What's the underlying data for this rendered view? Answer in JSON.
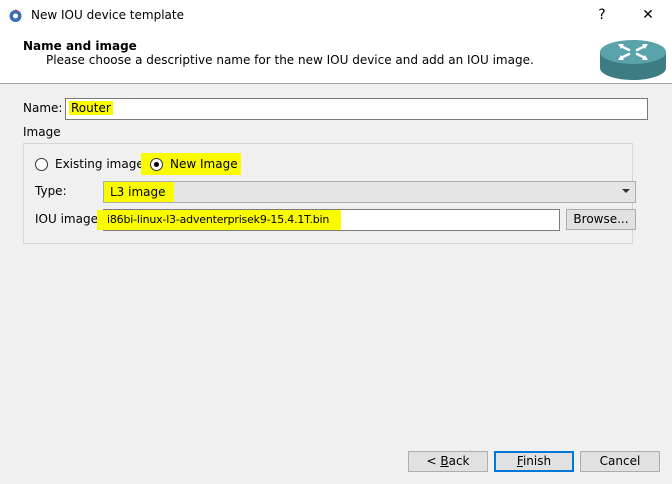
{
  "window": {
    "title": "New IOU device template",
    "help_label": "?",
    "close_label": "✕"
  },
  "header": {
    "title": "Name and image",
    "subtitle": "Please choose a descriptive name for the new IOU device and add an IOU image."
  },
  "form": {
    "name_label": "Name:",
    "name_value": "Router",
    "image_group_label": "Image",
    "existing_image_label": "Existing image",
    "new_image_label": "New Image",
    "selected_option": "New Image",
    "type_label": "Type:",
    "type_value": "L3 image",
    "iou_image_label": "IOU image:",
    "iou_image_value": "i86bi-linux-l3-adventerprisek9-15.4.1T.bin",
    "browse_label": "Browse..."
  },
  "footer": {
    "back_prefix": "< ",
    "back_key": "B",
    "back_rest": "ack",
    "finish_key": "F",
    "finish_rest": "inish",
    "cancel_label": "Cancel"
  },
  "colors": {
    "highlight": "#fbfb00",
    "accent": "#0078d7",
    "router": "#4a8f96"
  },
  "icons": {
    "app": "gns3-app-icon",
    "router": "router-icon"
  }
}
